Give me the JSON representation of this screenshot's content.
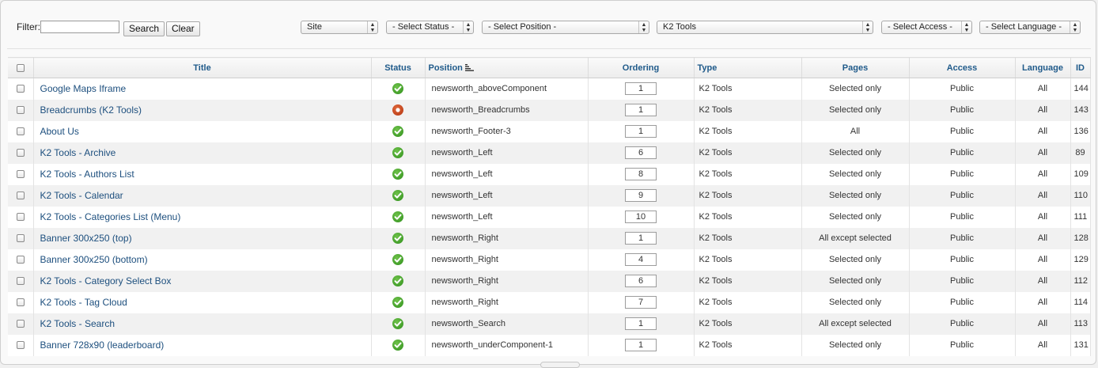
{
  "filter": {
    "label": "Filter:",
    "value": "",
    "search_label": "Search",
    "clear_label": "Clear"
  },
  "selects": {
    "client": "Site",
    "status": "- Select Status -",
    "position": "- Select Position -",
    "type": "K2 Tools",
    "access": "- Select Access -",
    "language": "- Select Language -"
  },
  "columns": {
    "title": "Title",
    "status": "Status",
    "position": "Position",
    "ordering": "Ordering",
    "type": "Type",
    "pages": "Pages",
    "access": "Access",
    "language": "Language",
    "id": "ID"
  },
  "rows": [
    {
      "title": "Google Maps Iframe",
      "status": "published",
      "position": "newsworth_aboveComponent",
      "ordering": "1",
      "type": "K2 Tools",
      "pages": "Selected only",
      "access": "Public",
      "language": "All",
      "id": "144"
    },
    {
      "title": "Breadcrumbs (K2 Tools)",
      "status": "unpublished",
      "position": "newsworth_Breadcrumbs",
      "ordering": "1",
      "type": "K2 Tools",
      "pages": "Selected only",
      "access": "Public",
      "language": "All",
      "id": "143"
    },
    {
      "title": "About Us",
      "status": "published",
      "position": "newsworth_Footer-3",
      "ordering": "1",
      "type": "K2 Tools",
      "pages": "All",
      "access": "Public",
      "language": "All",
      "id": "136"
    },
    {
      "title": "K2 Tools - Archive",
      "status": "published",
      "position": "newsworth_Left",
      "ordering": "6",
      "type": "K2 Tools",
      "pages": "Selected only",
      "access": "Public",
      "language": "All",
      "id": "89"
    },
    {
      "title": "K2 Tools - Authors List",
      "status": "published",
      "position": "newsworth_Left",
      "ordering": "8",
      "type": "K2 Tools",
      "pages": "Selected only",
      "access": "Public",
      "language": "All",
      "id": "109"
    },
    {
      "title": "K2 Tools - Calendar",
      "status": "published",
      "position": "newsworth_Left",
      "ordering": "9",
      "type": "K2 Tools",
      "pages": "Selected only",
      "access": "Public",
      "language": "All",
      "id": "110"
    },
    {
      "title": "K2 Tools - Categories List (Menu)",
      "status": "published",
      "position": "newsworth_Left",
      "ordering": "10",
      "type": "K2 Tools",
      "pages": "Selected only",
      "access": "Public",
      "language": "All",
      "id": "111"
    },
    {
      "title": "Banner 300x250 (top)",
      "status": "published",
      "position": "newsworth_Right",
      "ordering": "1",
      "type": "K2 Tools",
      "pages": "All except selected",
      "access": "Public",
      "language": "All",
      "id": "128"
    },
    {
      "title": "Banner 300x250 (bottom)",
      "status": "published",
      "position": "newsworth_Right",
      "ordering": "4",
      "type": "K2 Tools",
      "pages": "Selected only",
      "access": "Public",
      "language": "All",
      "id": "129"
    },
    {
      "title": "K2 Tools - Category Select Box",
      "status": "published",
      "position": "newsworth_Right",
      "ordering": "6",
      "type": "K2 Tools",
      "pages": "Selected only",
      "access": "Public",
      "language": "All",
      "id": "112"
    },
    {
      "title": "K2 Tools - Tag Cloud",
      "status": "published",
      "position": "newsworth_Right",
      "ordering": "7",
      "type": "K2 Tools",
      "pages": "Selected only",
      "access": "Public",
      "language": "All",
      "id": "114"
    },
    {
      "title": "K2 Tools - Search",
      "status": "published",
      "position": "newsworth_Search",
      "ordering": "1",
      "type": "K2 Tools",
      "pages": "All except selected",
      "access": "Public",
      "language": "All",
      "id": "113"
    },
    {
      "title": "Banner 728x90 (leaderboard)",
      "status": "published",
      "position": "newsworth_underComponent-1",
      "ordering": "1",
      "type": "K2 Tools",
      "pages": "Selected only",
      "access": "Public",
      "language": "All",
      "id": "131"
    }
  ]
}
